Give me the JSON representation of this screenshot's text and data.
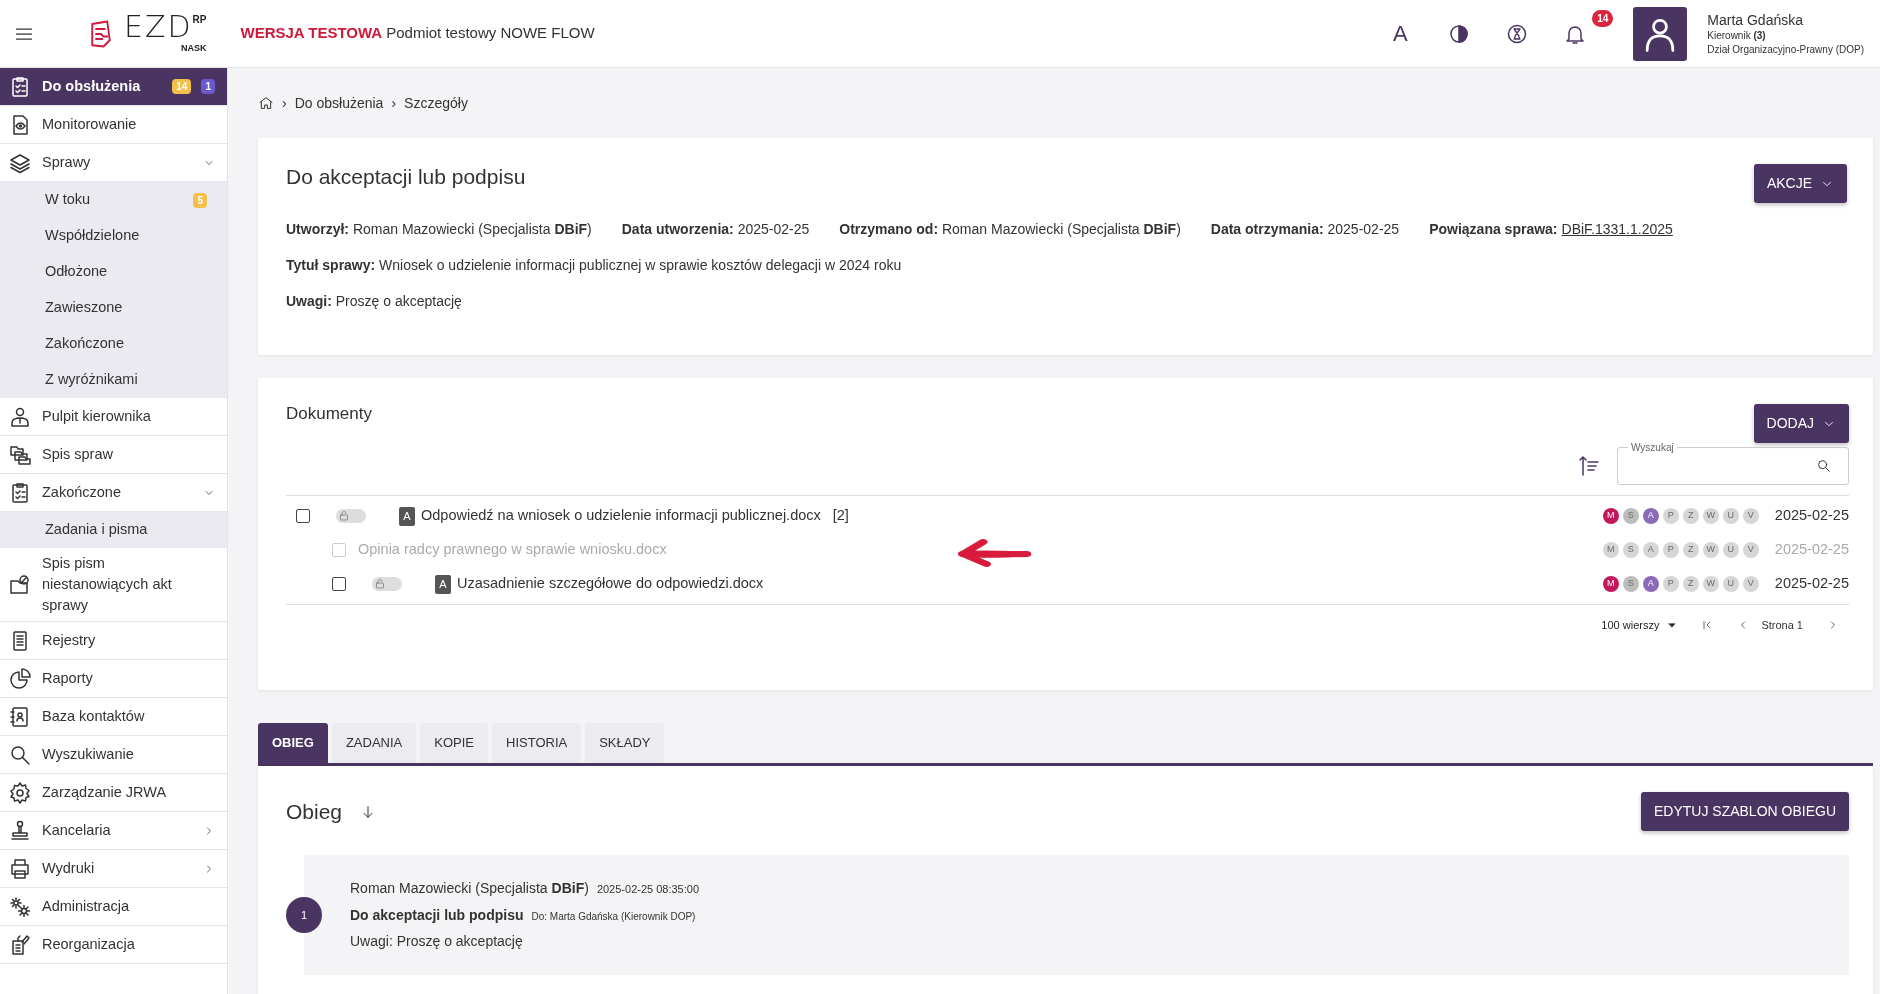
{
  "header": {
    "logo": {
      "main": "EZD",
      "sup": "RP",
      "sub": "NASK"
    },
    "env_label": "WERSJA TESTOWA",
    "env_name": "Podmiot testowy NOWE FLOW",
    "font_button": "A",
    "notifications": "14",
    "user": {
      "name": "Marta Gdańska",
      "role": "Kierownik **(3)**",
      "department": "Dział Organizacyjno-Prawny (DOP)"
    }
  },
  "sidebar": {
    "items": [
      {
        "label": "Do obsłużenia",
        "selected": true,
        "badges": [
          {
            "text": "14",
            "color": "#f5c04a"
          },
          {
            "text": "1",
            "color": "#6a5acd"
          }
        ]
      },
      {
        "label": "Monitorowanie",
        "selected": false
      },
      {
        "label": "Sprawy",
        "selected": false,
        "expanded": true,
        "children": [
          {
            "label": "W toku",
            "selected": false,
            "badges": [
              {
                "text": "5",
                "color": "#f5c04a"
              }
            ]
          },
          {
            "label": "Współdzielone",
            "selected": false
          },
          {
            "label": "Odłożone",
            "selected": false
          },
          {
            "label": "Zawieszone",
            "selected": false
          },
          {
            "label": "Zakończone",
            "selected": false
          },
          {
            "label": "Z wyróżnikami",
            "selected": false
          }
        ]
      },
      {
        "label": "Pulpit kierownika",
        "selected": false
      },
      {
        "label": "Spis spraw",
        "selected": false
      },
      {
        "label": "Zakończone",
        "selected": false,
        "expanded": true,
        "children": [
          {
            "label": "Zadania i pisma",
            "selected": false
          }
        ]
      },
      {
        "label": "Spis pism niestanowiących akt sprawy",
        "selected": false
      },
      {
        "label": "Rejestry",
        "selected": false
      },
      {
        "label": "Raporty",
        "selected": false
      },
      {
        "label": "Baza kontaktów",
        "selected": false
      },
      {
        "label": "Wyszukiwanie",
        "selected": false
      },
      {
        "label": "Zarządzanie JRWA",
        "selected": false
      },
      {
        "label": "Kancelaria",
        "selected": false,
        "expanded": false
      },
      {
        "label": "Wydruki",
        "selected": false,
        "expanded": false
      },
      {
        "label": "Administracja",
        "selected": false
      },
      {
        "label": "Reorganizacja",
        "selected": false
      }
    ]
  },
  "breadcrumb": {
    "separator": "›",
    "items": [
      "Do obsłużenia",
      "Szczegóły"
    ]
  },
  "details": {
    "title": "Do akceptacji lub podpisu",
    "action_button": "AKCJE",
    "lines": [
      [
        {
          "label": "Utworzył:",
          "value": "Roman Mazowiecki (Specjalista **DBiF**)",
          "kind": "text"
        },
        {
          "label": "Data utworzenia:",
          "value": "2025-02-25",
          "kind": "text"
        },
        {
          "label": "Otrzymano od:",
          "value": "Roman Mazowiecki (Specjalista **DBiF**)",
          "kind": "text"
        },
        {
          "label": "Data otrzymania:",
          "value": "2025-02-25",
          "kind": "text"
        },
        {
          "label": "Powiązana sprawa:",
          "value": "DBiF.1331.1.2025",
          "kind": "link"
        }
      ],
      [
        {
          "label": "Tytuł sprawy:",
          "value": "Wniosek o udzielenie informacji publicznej w sprawie kosztów delegacji w 2024 roku",
          "kind": "text"
        }
      ],
      [
        {
          "label": "Uwagi:",
          "value": "Proszę o akceptację",
          "kind": "text"
        }
      ]
    ]
  },
  "documents": {
    "title": "Dokumenty",
    "add_button": "DODAJ",
    "search": {
      "label": "Wyszukaj"
    },
    "rows": [
      {
        "kind": "document",
        "checked": false,
        "disabled": false,
        "type_letter": "A",
        "name": "Odpowiedź na wniosek o udzielenie informacji publicznej.docx",
        "count": "[2]",
        "date": "2025-02-25",
        "statuses": [
          {
            "letter": "M",
            "color": "#c2185b"
          },
          {
            "letter": "S",
            "color": "#bdbdbd"
          },
          {
            "letter": "A",
            "color": "#8b6bb8"
          },
          {
            "letter": "P",
            "color": "#d6d6d6"
          },
          {
            "letter": "Z",
            "color": "#d6d6d6"
          },
          {
            "letter": "W",
            "color": "#d6d6d6"
          },
          {
            "letter": "U",
            "color": "#d6d6d6"
          },
          {
            "letter": "V",
            "color": "#d6d6d6"
          }
        ],
        "children": [
          {
            "kind": "attachment",
            "checked": false,
            "disabled": true,
            "name": "Opinia radcy prawnego w sprawie wniosku.docx",
            "date": "2025-02-25",
            "statuses": [
              {
                "letter": "M",
                "color": "#d6d6d6"
              },
              {
                "letter": "S",
                "color": "#d6d6d6"
              },
              {
                "letter": "A",
                "color": "#d6d6d6"
              },
              {
                "letter": "P",
                "color": "#d6d6d6"
              },
              {
                "letter": "Z",
                "color": "#d6d6d6"
              },
              {
                "letter": "W",
                "color": "#d6d6d6"
              },
              {
                "letter": "U",
                "color": "#d6d6d6"
              },
              {
                "letter": "V",
                "color": "#d6d6d6"
              }
            ]
          },
          {
            "kind": "document",
            "checked": false,
            "disabled": false,
            "type_letter": "A",
            "name": "Uzasadnienie szczegółowe do odpowiedzi.docx",
            "date": "2025-02-25",
            "statuses": [
              {
                "letter": "M",
                "color": "#c2185b"
              },
              {
                "letter": "S",
                "color": "#bdbdbd"
              },
              {
                "letter": "A",
                "color": "#8b6bb8"
              },
              {
                "letter": "P",
                "color": "#d6d6d6"
              },
              {
                "letter": "Z",
                "color": "#d6d6d6"
              },
              {
                "letter": "W",
                "color": "#d6d6d6"
              },
              {
                "letter": "U",
                "color": "#d6d6d6"
              },
              {
                "letter": "V",
                "color": "#d6d6d6"
              }
            ]
          }
        ]
      }
    ],
    "pagination": {
      "rows_per_page": "100 wierszy",
      "page": "Strona 1"
    }
  },
  "tabs": [
    {
      "label": "OBIEG",
      "selected": true
    },
    {
      "label": "ZADANIA",
      "selected": false
    },
    {
      "label": "KOPIE",
      "selected": false
    },
    {
      "label": "HISTORIA",
      "selected": false
    },
    {
      "label": "SKŁADY",
      "selected": false
    }
  ],
  "flow": {
    "title": "Obieg",
    "edit_button": "EDYTUJ SZABLON OBIEGU",
    "entries": [
      {
        "number": "1",
        "author": "Roman Mazowiecki (Specjalista **DBiF**)",
        "time": "2025-02-25 08:35:00",
        "action": "Do akceptacji lub podpisu",
        "recipient": "Do: Marta Gdańska (Kierownik DOP)",
        "note": "Uwagi: Proszę o akceptację"
      }
    ]
  }
}
